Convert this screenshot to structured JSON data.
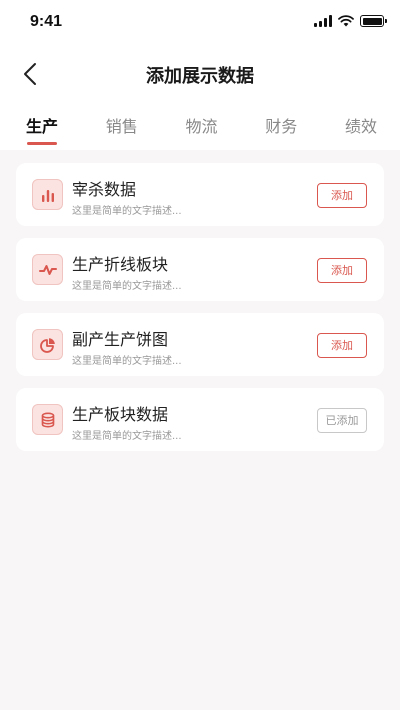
{
  "status_bar": {
    "time": "9:41",
    "signal_icon": "cellular-signal-icon",
    "wifi_icon": "wifi-icon",
    "battery_icon": "battery-icon"
  },
  "header": {
    "back_icon": "chevron-left-icon",
    "title": "添加展示数据"
  },
  "tabs": [
    {
      "label": "生产",
      "active": true
    },
    {
      "label": "销售",
      "active": false
    },
    {
      "label": "物流",
      "active": false
    },
    {
      "label": "财务",
      "active": false
    },
    {
      "label": "绩效",
      "active": false
    }
  ],
  "items": [
    {
      "icon": "bar-chart-icon",
      "title": "宰杀数据",
      "desc": "这里是简单的文字描述...",
      "button": "添加",
      "added": false
    },
    {
      "icon": "line-chart-icon",
      "title": "生产折线板块",
      "desc": "这里是简单的文字描述...",
      "button": "添加",
      "added": false
    },
    {
      "icon": "pie-chart-icon",
      "title": "副产生产饼图",
      "desc": "这里是简单的文字描述...",
      "button": "添加",
      "added": false
    },
    {
      "icon": "database-icon",
      "title": "生产板块数据",
      "desc": "这里是简单的文字描述...",
      "button": "已添加",
      "added": true
    }
  ],
  "colors": {
    "accent": "#d9574e",
    "icon_bg": "#fbe3e1",
    "page_bg": "#f8f6f7",
    "muted": "#999999"
  }
}
